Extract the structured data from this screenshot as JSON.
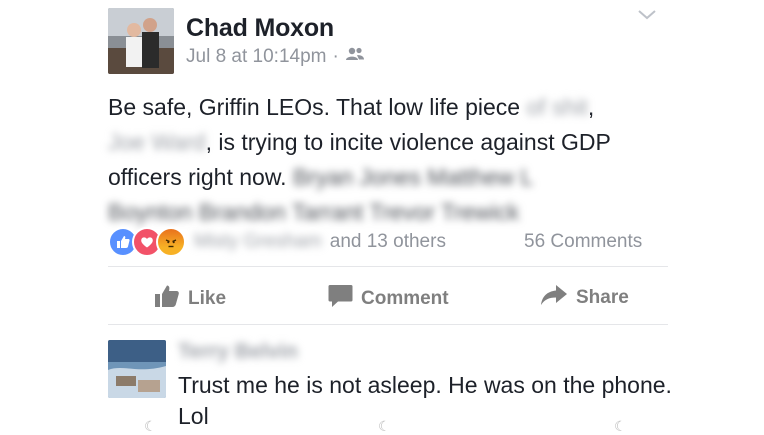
{
  "post": {
    "author": "Chad Moxon",
    "timestamp": "Jul 8 at 10:14pm",
    "separator": "·",
    "privacy_icon": "friends-icon",
    "text_part1": "Be safe, Griffin LEOs. That low life piece",
    "blur_1": "of shit",
    "text_comma": ",",
    "blur_2": "Joe Ward",
    "text_part2": ", is trying to incite violence against GDP officers right now.",
    "blur_tags_1": "Bryan Jones Matthew L",
    "blur_tags_2": "Boynton Brandon Tarrant  Trevor Trewick"
  },
  "reactions": {
    "icons": [
      "like-icon",
      "love-icon",
      "angry-icon"
    ],
    "blurred_name": "Misty Gresham",
    "others": "and 13 others",
    "comments": "56 Comments"
  },
  "actions": {
    "like": "Like",
    "comment": "Comment",
    "share": "Share"
  },
  "comment": {
    "name_blurred": "Terry Belvin",
    "text": "Trust me he is not asleep. He was on the phone. Lol"
  },
  "colors": {
    "text": "#1d2129",
    "muted": "#90949c",
    "like_blue": "#5890ff",
    "love_red": "#f25268",
    "angry_yellow": "#f7b125"
  }
}
